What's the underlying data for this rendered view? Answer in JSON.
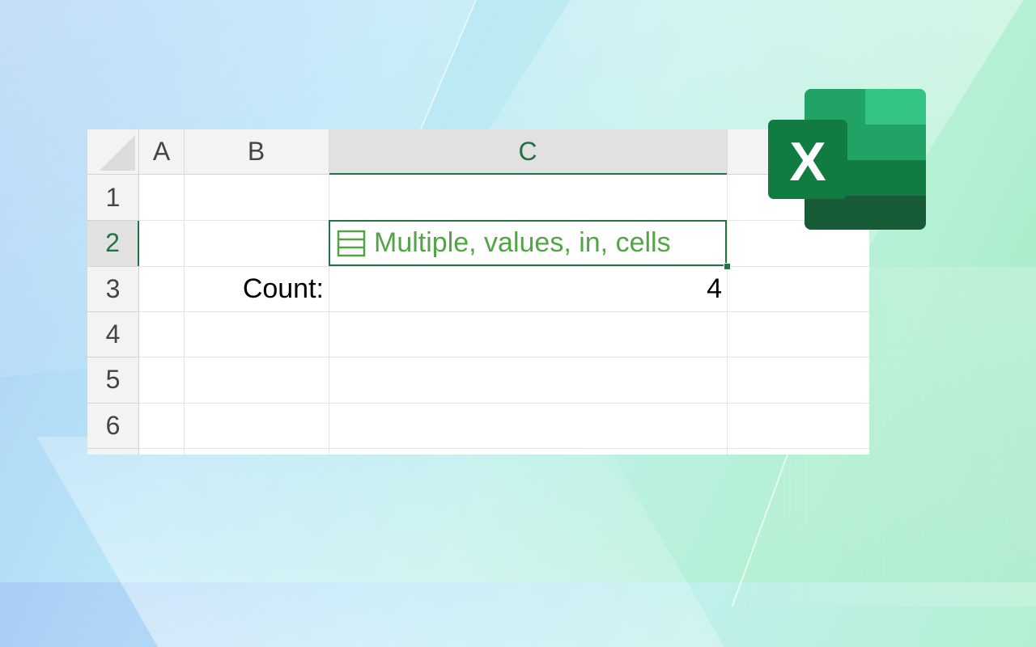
{
  "sheet": {
    "columns": [
      {
        "label": "A"
      },
      {
        "label": "B"
      },
      {
        "label": "C"
      }
    ],
    "rows": [
      {
        "label": "1"
      },
      {
        "label": "2"
      },
      {
        "label": "3"
      },
      {
        "label": "4"
      },
      {
        "label": "5"
      },
      {
        "label": "6"
      }
    ],
    "cells": {
      "C2": "Multiple, values, in, cells",
      "B3": "Count:",
      "C3": "4"
    },
    "active_cell": "C2",
    "accent_color": "#217346",
    "value_color": "#52a447"
  },
  "logo": {
    "letter": "X",
    "icon": "excel-logo",
    "colors": [
      "#33c481",
      "#21a366",
      "#107c41",
      "#185c37"
    ]
  }
}
